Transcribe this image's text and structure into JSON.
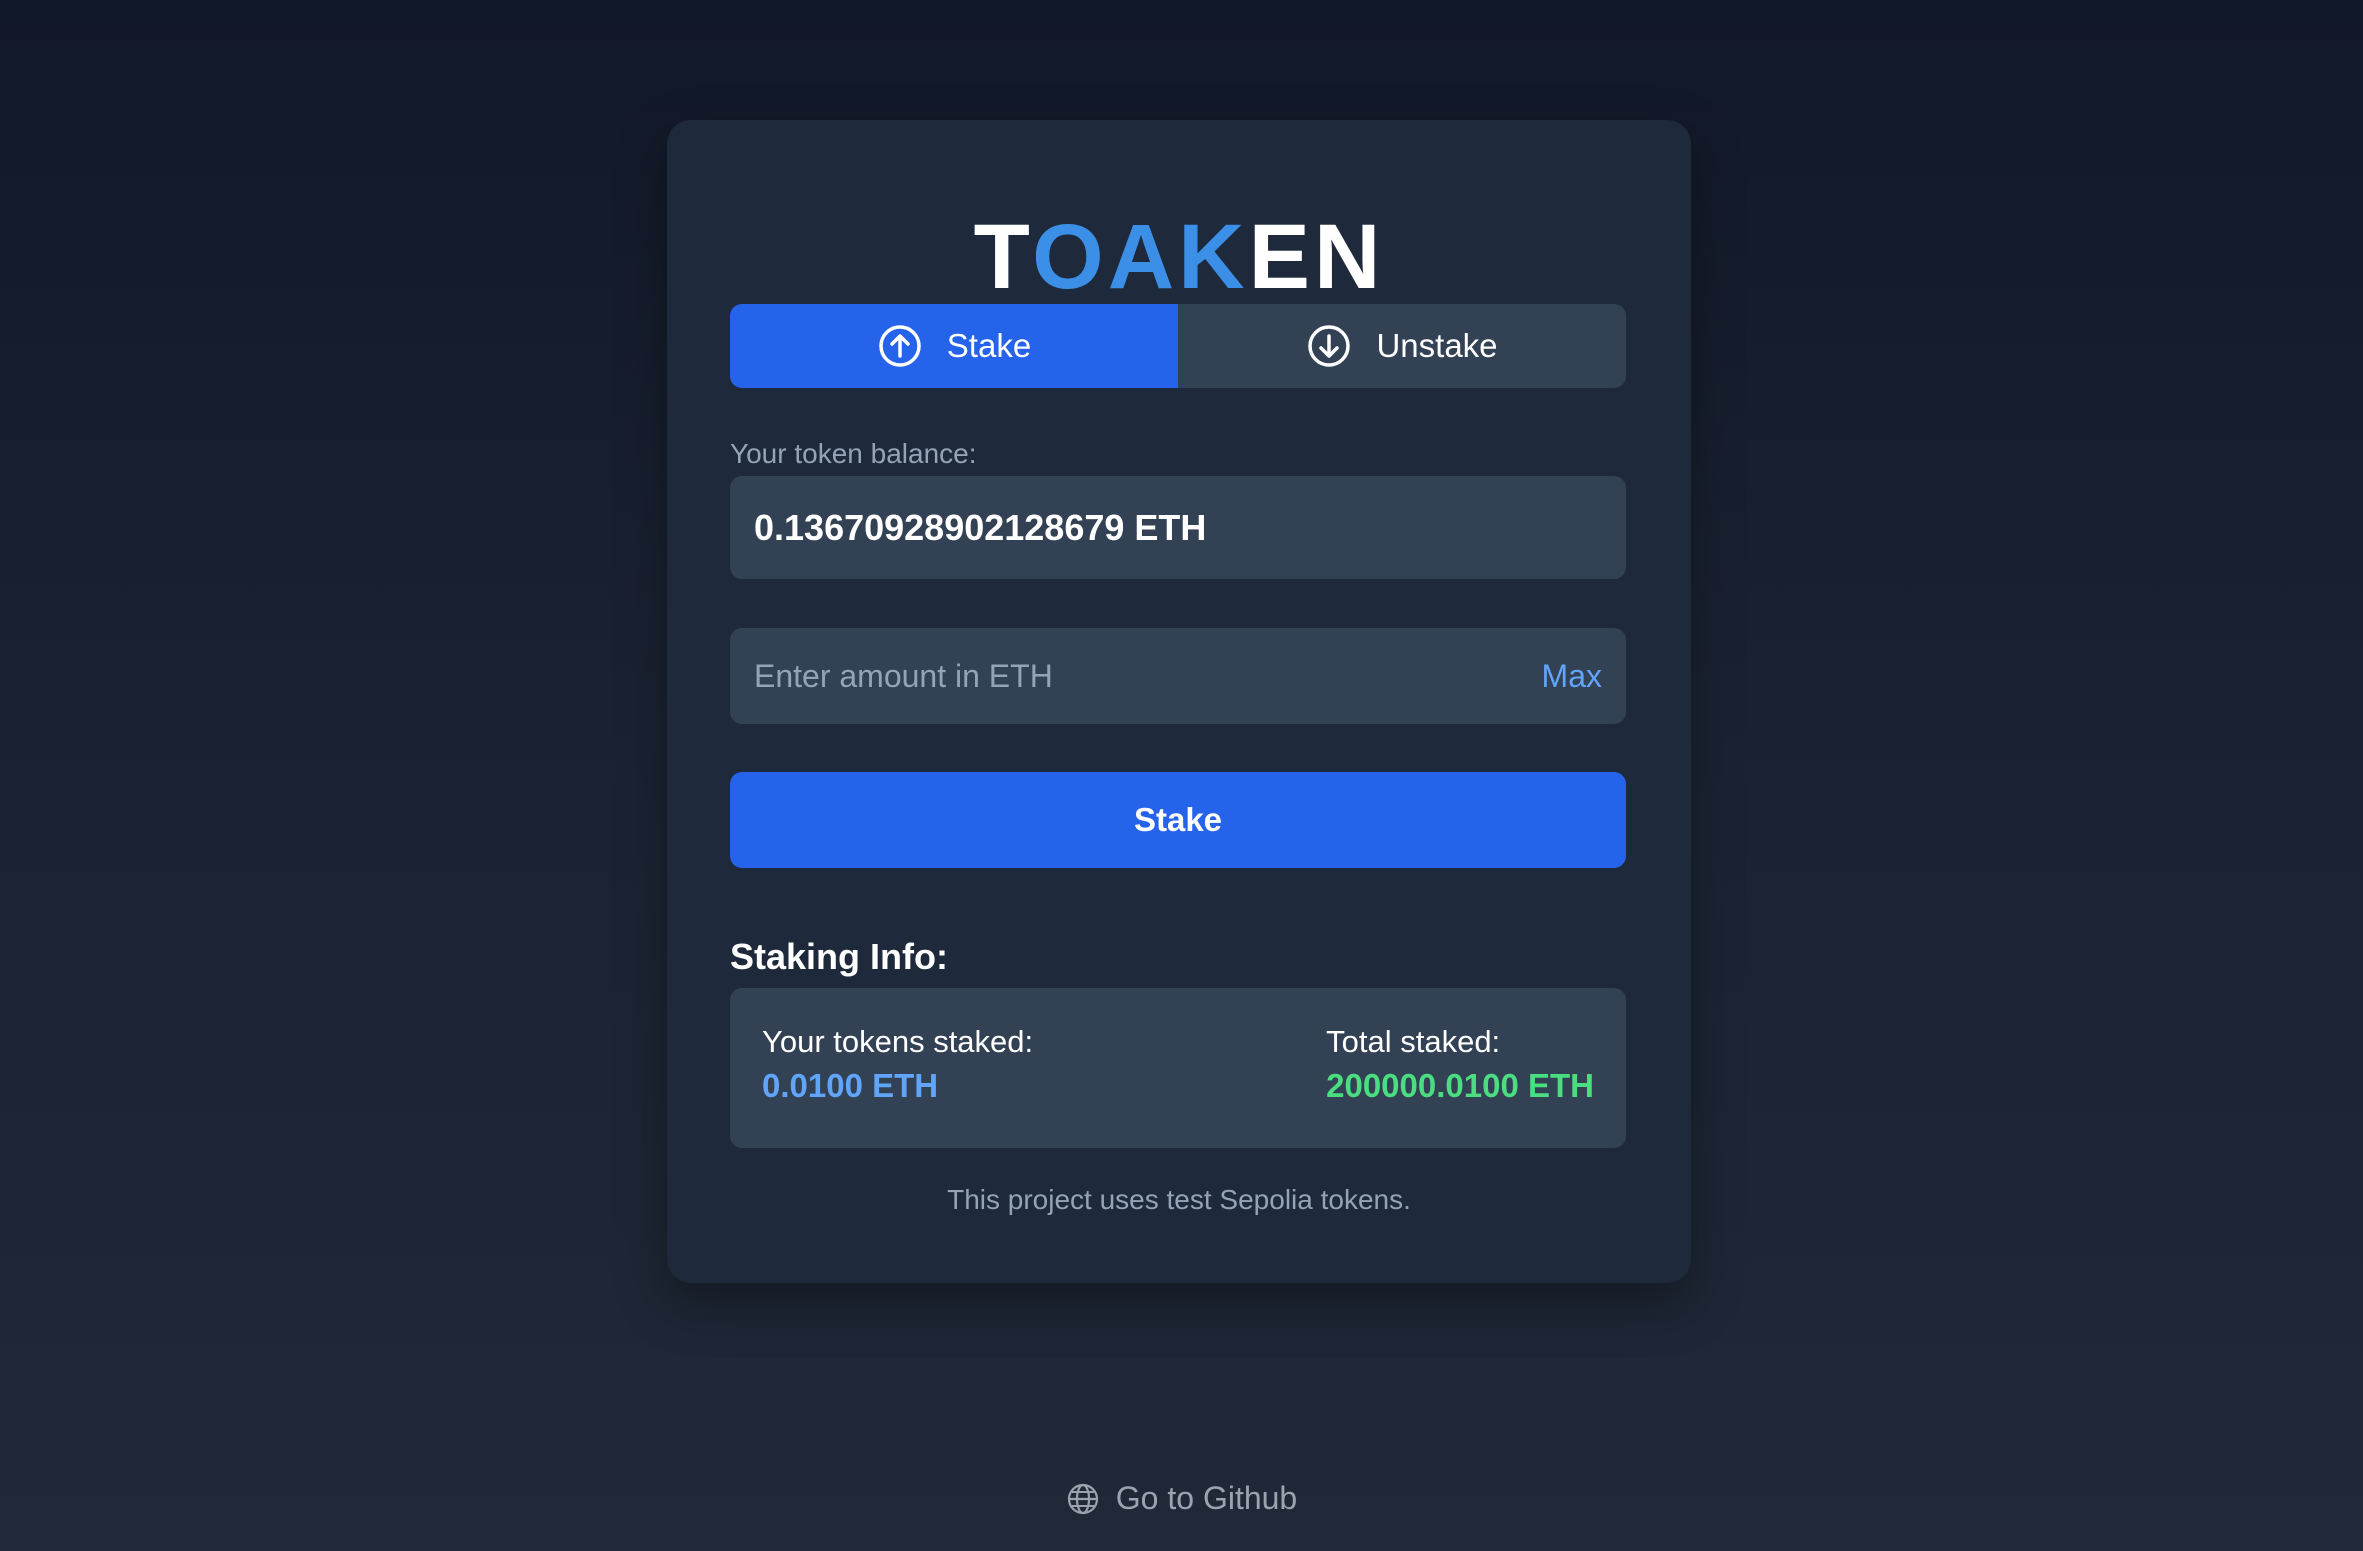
{
  "logo": {
    "text": "TOAKEN",
    "white_part_1": "T",
    "blue_part": "OAK",
    "white_part_2": "EN",
    "colors": {
      "white": "#ffffff",
      "blue": "#3b8fe6"
    }
  },
  "tabs": [
    {
      "label": "Stake",
      "icon": "arrow-up-circle-icon",
      "active": true
    },
    {
      "label": "Unstake",
      "icon": "arrow-down-circle-icon",
      "active": false
    }
  ],
  "balance": {
    "label": "Your token balance:",
    "value": "0.13670928902128679 ETH"
  },
  "amount": {
    "placeholder": "Enter amount in ETH",
    "value": "",
    "max_label": "Max"
  },
  "action": {
    "label": "Stake"
  },
  "staking_info": {
    "heading": "Staking Info:",
    "yours_label": "Your tokens staked:",
    "yours_value": "0.0100 ETH",
    "total_label": "Total staked:",
    "total_value": "200000.0100 ETH"
  },
  "note": "This project uses test Sepolia tokens.",
  "footer": {
    "github_label": "Go to Github",
    "icon": "globe-icon"
  },
  "colors": {
    "accent": "#2563eb",
    "panel": "#1e293b",
    "field": "#334155",
    "value_blue": "#60a5fa",
    "value_green": "#4ade80"
  }
}
